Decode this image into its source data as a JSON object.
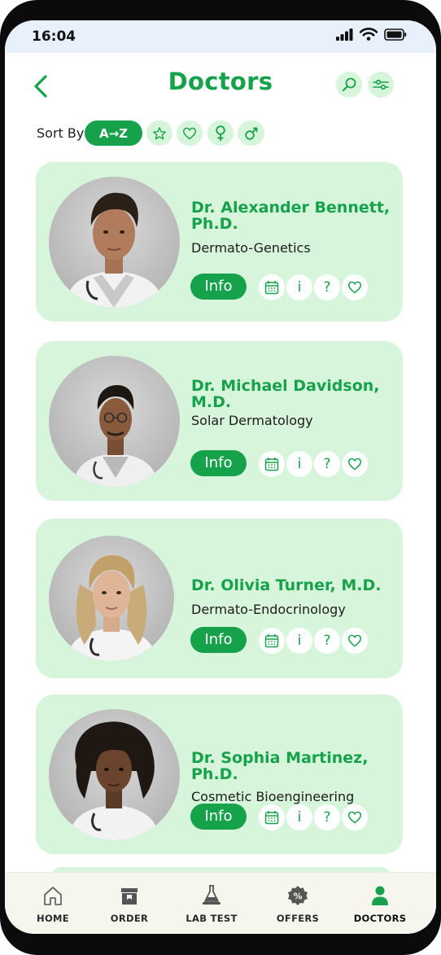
{
  "status": {
    "time": "16:04"
  },
  "header": {
    "title": "Doctors"
  },
  "sort": {
    "label": "Sort By",
    "chips": {
      "az": "A→Z"
    }
  },
  "doctors": [
    {
      "name": "Dr. Alexander Bennett, Ph.D.",
      "specialty": "Dermato-Genetics",
      "info_label": "Info"
    },
    {
      "name": "Dr. Michael Davidson, M.D.",
      "specialty": "Solar Dermatology",
      "info_label": "Info"
    },
    {
      "name": "Dr. Olivia Turner, M.D.",
      "specialty": "Dermato-Endocrinology",
      "info_label": "Info"
    },
    {
      "name": "Dr. Sophia Martinez, Ph.D.",
      "specialty": "Cosmetic Bioengineering",
      "info_label": "Info"
    }
  ],
  "card_actions": {
    "info_icon": "i",
    "question_icon": "?"
  },
  "nav": {
    "items": [
      {
        "label": "HOME",
        "icon": "home-icon"
      },
      {
        "label": "ORDER",
        "icon": "order-icon"
      },
      {
        "label": "LAB TEST",
        "icon": "flask-icon"
      },
      {
        "label": "OFFERS",
        "icon": "discount-badge-icon"
      },
      {
        "label": "DOCTORS",
        "icon": "person-icon",
        "active": true
      }
    ]
  },
  "colors": {
    "accent": "#15a24a",
    "card_bg": "#d6f5da",
    "status_bg": "#e8f0fb",
    "nav_bg": "#f7f6ee"
  }
}
